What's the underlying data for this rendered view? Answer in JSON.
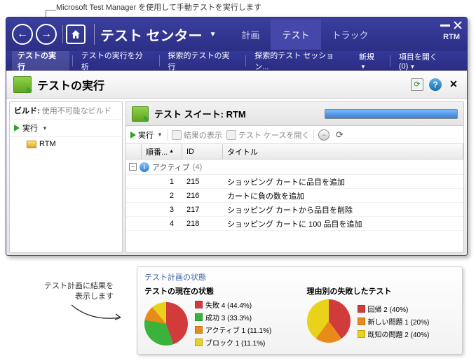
{
  "callouts": {
    "top": "Microsoft Test Manager を使用して手動テストを実行します",
    "left_l1": "テスト計画に結果を",
    "left_l2": "表示します"
  },
  "window": {
    "rtm_badge": "RTM",
    "app_title": "テスト センター",
    "tabs": {
      "plan": "計画",
      "test": "テスト",
      "track": "トラック"
    }
  },
  "subnav": {
    "run_tests": "テストの実行",
    "analyze": "テストの実行を分析",
    "exploratory": "探索的テストの実行",
    "exploratory_session": "探索的テスト セッション...",
    "new": "新規",
    "open_item": "項目を開く (0)"
  },
  "page": {
    "title": "テストの実行"
  },
  "left_panel": {
    "build_label": "ビルド:",
    "build_value": "使用不可能なビルド",
    "run_label": "実行",
    "tree_item": "RTM"
  },
  "suite": {
    "label": "テスト スイート:",
    "name": "RTM"
  },
  "toolbar": {
    "run": "実行",
    "show_results": "結果の表示",
    "open_case": "テスト ケースを開く"
  },
  "grid": {
    "col_order": "順番...",
    "col_id": "ID",
    "col_title": "タイトル",
    "group_label": "アクティブ",
    "group_count": "(4)",
    "rows": [
      {
        "order": "1",
        "id": "215",
        "title": "ショッピング カートに品目を追加"
      },
      {
        "order": "2",
        "id": "216",
        "title": "カートに負の数を追加"
      },
      {
        "order": "3",
        "id": "217",
        "title": "ショッピング カートから品目を削除"
      },
      {
        "order": "4",
        "id": "218",
        "title": "ショッピング カートに 100 品目を追加"
      }
    ]
  },
  "status_panel": {
    "title": "テスト計画の状態",
    "col1_title": "テストの現在の状態",
    "col2_title": "理由別の失敗したテスト"
  },
  "chart_data": [
    {
      "type": "pie",
      "title": "テストの現在の状態",
      "series": [
        {
          "name": "失敗 4 (44.4%)",
          "value": 44.4,
          "color": "#d23b3b"
        },
        {
          "name": "成功 3 (33.3%)",
          "value": 33.3,
          "color": "#3bb23b"
        },
        {
          "name": "アクティブ 1 (11.1%)",
          "value": 11.1,
          "color": "#e88b1a"
        },
        {
          "name": "ブロック 1 (11.1%)",
          "value": 11.1,
          "color": "#e8d21a"
        }
      ]
    },
    {
      "type": "pie",
      "title": "理由別の失敗したテスト",
      "series": [
        {
          "name": "回帰 2 (40%)",
          "value": 40,
          "color": "#d23b3b"
        },
        {
          "name": "新しい問題 1 (20%)",
          "value": 20,
          "color": "#e88b1a"
        },
        {
          "name": "既知の問題 2 (40%)",
          "value": 40,
          "color": "#e8d21a"
        }
      ]
    }
  ]
}
